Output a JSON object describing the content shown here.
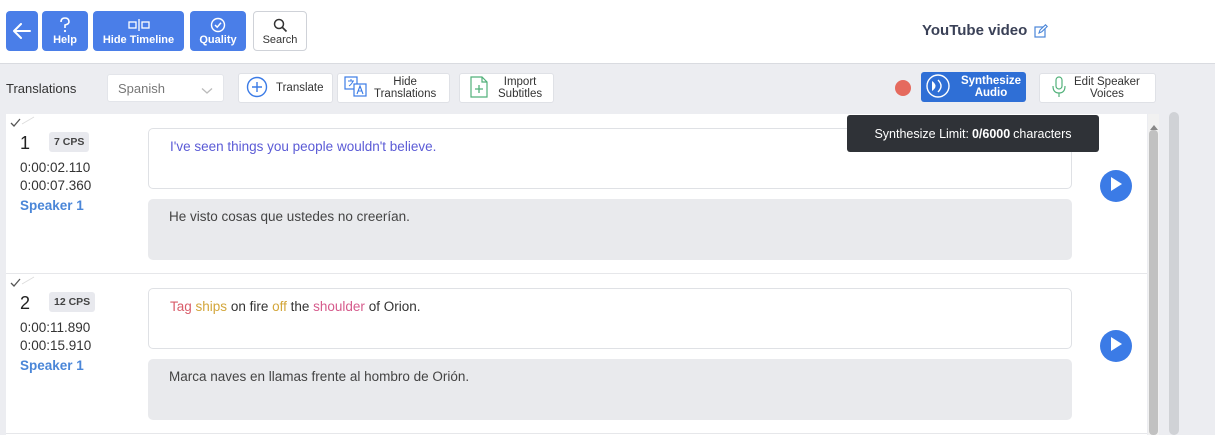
{
  "toolbar": {
    "help_label": "Help",
    "hide_timeline_label": "Hide Timeline",
    "quality_label": "Quality",
    "search_label": "Search",
    "video_title": "YouTube video"
  },
  "subbar": {
    "translations_label": "Translations",
    "language_selected": "Spanish",
    "translate_label": "Translate",
    "hide_translations_line1": "Hide",
    "hide_translations_line2": "Translations",
    "import_subtitles_line1": "Import",
    "import_subtitles_line2": "Subtitles",
    "synthesize_line1": "Synthesize",
    "synthesize_line2": "Audio",
    "edit_speaker_line1": "Edit Speaker",
    "edit_speaker_line2": "Voices"
  },
  "tooltip": {
    "prefix": "Synthesize Limit:",
    "value": "0/6000",
    "suffix": "characters"
  },
  "segments": [
    {
      "number": "1",
      "cps": "7 CPS",
      "start": "0:00:02.110",
      "end": "0:00:07.360",
      "speaker": "Speaker 1",
      "source": "I've seen things you people wouldn't believe.",
      "translation": "He visto cosas que ustedes no creerían."
    },
    {
      "number": "2",
      "cps": "12 CPS",
      "start": "0:00:11.890",
      "end": "0:00:15.910",
      "speaker": "Speaker 1",
      "source_parts": [
        "Tag",
        " ",
        "ships",
        " on fire ",
        "off",
        " the ",
        "shoulder",
        " of Orion."
      ],
      "translation": "Marca naves en llamas frente al hombro de Orión."
    }
  ],
  "colors": {
    "primary": "#4a7ee8",
    "synthesize": "#2f6fd6",
    "record_dot": "#e56a5e",
    "speaker_text": "#4a86d8",
    "source_text": "#5b5bd6"
  },
  "icons": [
    "arrow-left-icon",
    "question-icon",
    "timeline-icon",
    "check-badge-icon",
    "search-icon",
    "edit-icon",
    "chevron-down-icon",
    "plus-circle-icon",
    "translate-icon",
    "import-file-icon",
    "audio-wave-icon",
    "microphone-icon",
    "check-icon",
    "play-icon"
  ]
}
